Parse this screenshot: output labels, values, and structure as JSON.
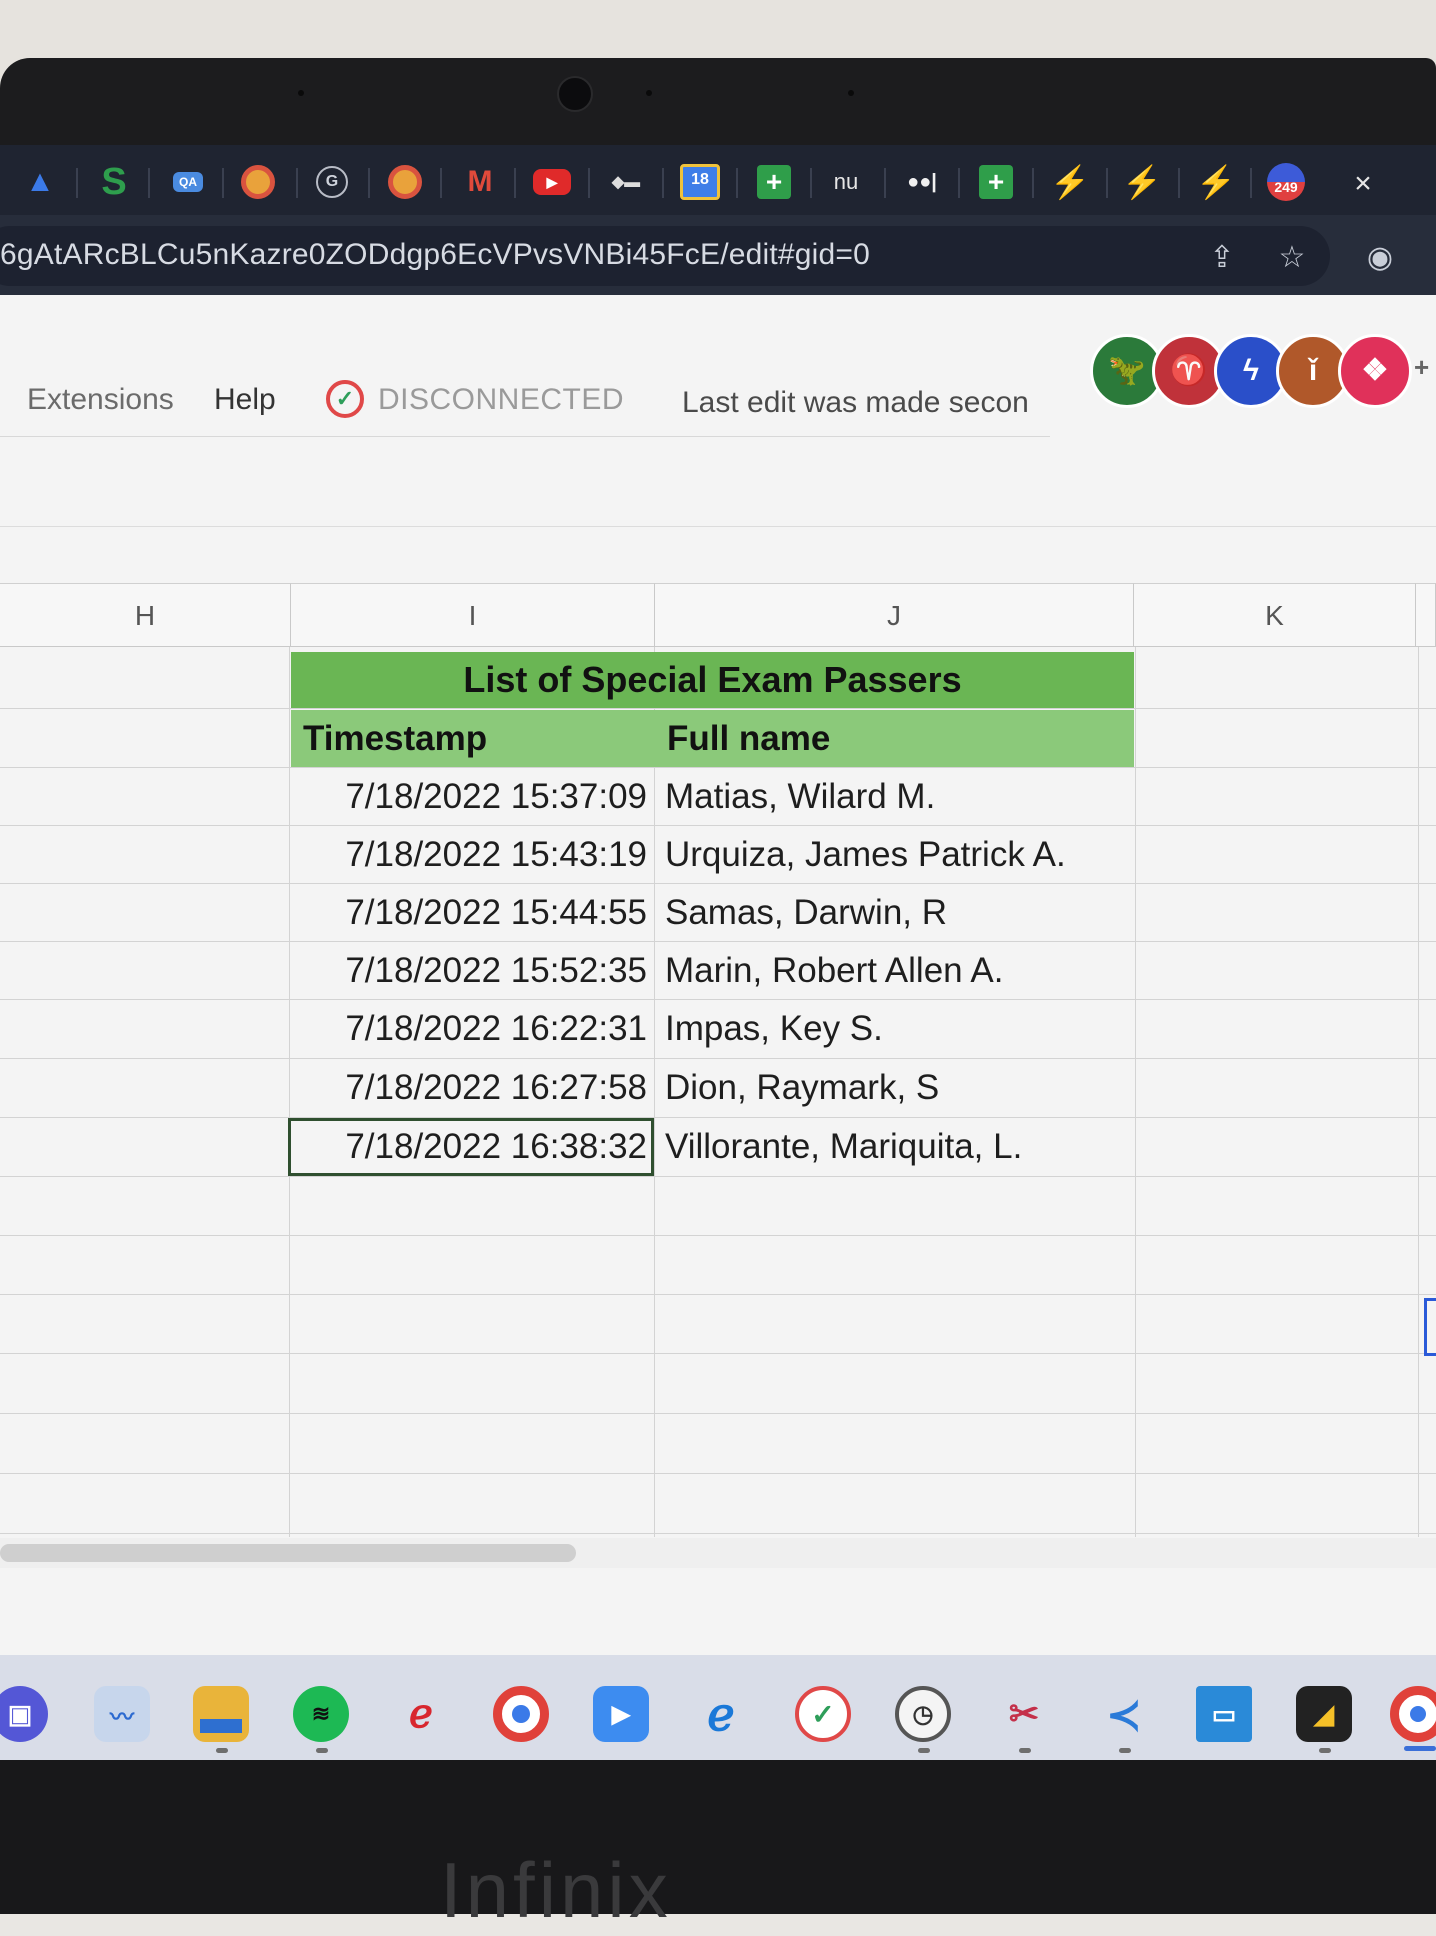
{
  "browser": {
    "tab_close": "×",
    "tab_labels": {
      "calendar_day": "18",
      "nu": "nu",
      "mail_badge": "249"
    },
    "url": "6gAtARcBLCu5nKazre0ZODdgp6EcVPvsVNBi45FcE/edit#gid=0"
  },
  "sheets": {
    "menu": {
      "extensions": "Extensions",
      "help": "Help"
    },
    "status": "DISCONNECTED",
    "last_edit": "Last edit was made secon",
    "more_collaborators": "+",
    "columns": [
      "H",
      "I",
      "J",
      "K"
    ],
    "table": {
      "title": "List of Special Exam Passers",
      "headers": {
        "timestamp": "Timestamp",
        "full_name": "Full name"
      },
      "rows": [
        {
          "timestamp": "7/18/2022 15:37:09",
          "name": "Matias, Wilard M."
        },
        {
          "timestamp": "7/18/2022 15:43:19",
          "name": "Urquiza, James Patrick A."
        },
        {
          "timestamp": "7/18/2022 15:44:55",
          "name": "Samas, Darwin, R"
        },
        {
          "timestamp": "7/18/2022 15:52:35",
          "name": "Marin, Robert Allen A."
        },
        {
          "timestamp": "7/18/2022 16:22:31",
          "name": "Impas, Key S."
        },
        {
          "timestamp": "7/18/2022 16:27:58",
          "name": "Dion, Raymark, S"
        },
        {
          "timestamp": "7/18/2022 16:38:32",
          "name": "Villorante, Mariquita, L."
        }
      ]
    }
  },
  "device": {
    "brand": "Infinix"
  },
  "colors": {
    "title_band": "#6ab654",
    "header_band": "#8bc97a",
    "selection_border": "#2f4f2f"
  }
}
